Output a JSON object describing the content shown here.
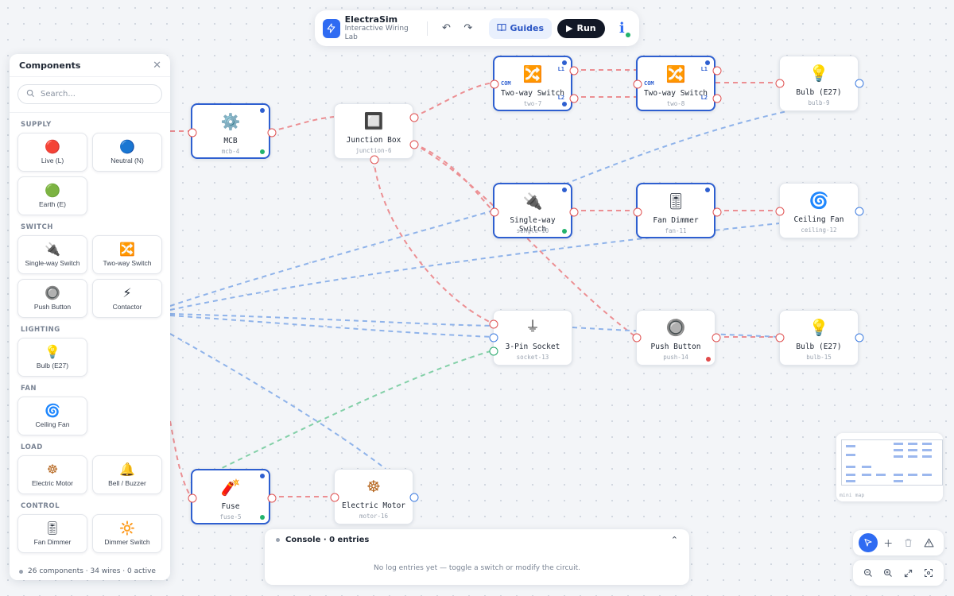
{
  "app": {
    "name": "ElectraSim",
    "subtitle": "Interactive Wiring Lab",
    "guides_label": "Guides",
    "run_label": "Run"
  },
  "sidebar": {
    "title": "Components",
    "search_placeholder": "Search...",
    "categories": [
      {
        "name": "SUPPLY",
        "items": [
          {
            "label": "Live (L)",
            "icon": "🔴"
          },
          {
            "label": "Neutral (N)",
            "icon": "🔵"
          },
          {
            "label": "Earth (E)",
            "icon": "🟢"
          }
        ]
      },
      {
        "name": "SWITCH",
        "items": [
          {
            "label": "Single-way Switch",
            "icon": "🔌"
          },
          {
            "label": "Two-way Switch",
            "icon": "🔀"
          },
          {
            "label": "Push Button",
            "icon": "🔘"
          },
          {
            "label": "Contactor",
            "icon": "⚡"
          }
        ]
      },
      {
        "name": "LIGHTING",
        "items": [
          {
            "label": "Bulb (E27)",
            "icon": "💡"
          }
        ]
      },
      {
        "name": "FAN",
        "items": [
          {
            "label": "Ceiling Fan",
            "icon": "🌀"
          }
        ]
      },
      {
        "name": "LOAD",
        "items": [
          {
            "label": "Electric Motor",
            "icon": "☸"
          },
          {
            "label": "Bell / Buzzer",
            "icon": "🔔"
          }
        ]
      },
      {
        "name": "CONTROL",
        "items": [
          {
            "label": "Fan Dimmer",
            "icon": "🎚"
          },
          {
            "label": "Dimmer Switch",
            "icon": "🔆"
          }
        ]
      }
    ],
    "footer": "26 components · 34 wires · 0 active"
  },
  "nodes": [
    {
      "key": "mcb",
      "label": "MCB",
      "id": "mcb-4",
      "icon": "⚙️"
    },
    {
      "key": "junction",
      "label": "Junction Box",
      "id": "junction-6",
      "icon": "🔲"
    },
    {
      "key": "two7",
      "label": "Two-way Switch",
      "id": "two-7",
      "icon": "🔀",
      "tags": [
        "COM",
        "L1",
        "L2"
      ]
    },
    {
      "key": "two8",
      "label": "Two-way Switch",
      "id": "two-8",
      "icon": "🔀",
      "tags": [
        "COM",
        "L1",
        "L2"
      ]
    },
    {
      "key": "bulb9",
      "label": "Bulb (E27)",
      "id": "bulb-9",
      "icon": "💡"
    },
    {
      "key": "single10",
      "label": "Single-way Switch",
      "id": "single-10",
      "icon": "🔌"
    },
    {
      "key": "fan11",
      "label": "Fan Dimmer",
      "id": "fan-11",
      "icon": "🎚"
    },
    {
      "key": "ceiling12",
      "label": "Ceiling Fan",
      "id": "ceiling-12",
      "icon": "🌀"
    },
    {
      "key": "socket13",
      "label": "3-Pin Socket",
      "id": "socket-13",
      "icon": "⏚"
    },
    {
      "key": "push14",
      "label": "Push Button",
      "id": "push-14",
      "icon": "🔘"
    },
    {
      "key": "bulb15",
      "label": "Bulb (E27)",
      "id": "bulb-15",
      "icon": "💡"
    },
    {
      "key": "fuse5",
      "label": "Fuse",
      "id": "fuse-5",
      "icon": "🧨"
    },
    {
      "key": "motor16",
      "label": "Electric Motor",
      "id": "motor-16",
      "icon": "☸"
    }
  ],
  "minimap": {
    "label": "mini map"
  },
  "console": {
    "title": "Console · 0 entries",
    "empty_text": "No log entries yet — toggle a switch or modify the circuit."
  },
  "colors": {
    "accent": "#2f6bf2",
    "live_wire": "#ec8f93",
    "neutral_wire": "#8fb3ea",
    "earth_wire": "#83d0a8"
  }
}
